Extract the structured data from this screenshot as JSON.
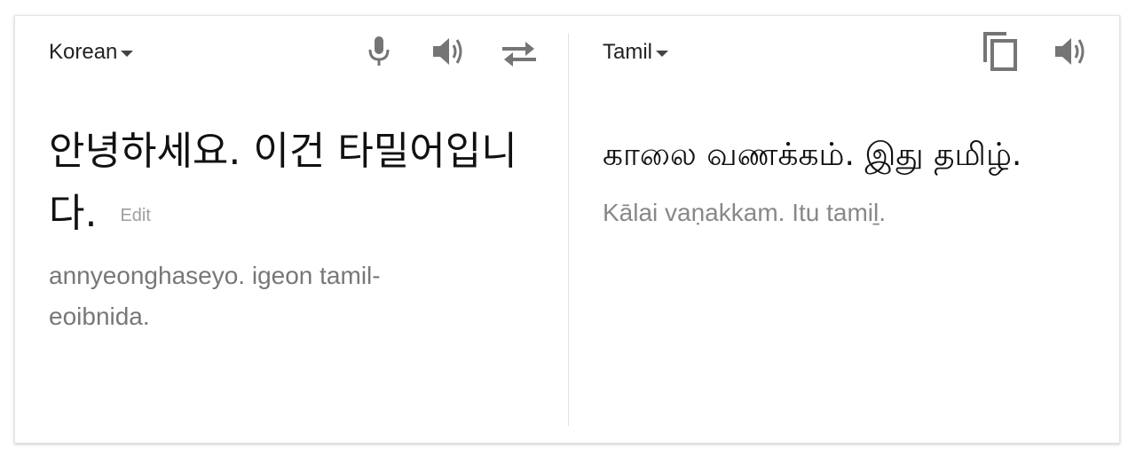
{
  "source": {
    "language": "Korean",
    "text": "안녕하세요. 이건 타밀어입니다.",
    "edit_label": "Edit",
    "transliteration": "annyeonghaseyo. igeon tamil-eoibnida."
  },
  "target": {
    "language": "Tamil",
    "text": "காலை வணக்கம். இது தமிழ்.",
    "transliteration": "Kālai vaṇakkam. Itu tamiḻ."
  },
  "icons": {
    "source_toolbar": [
      "microphone-icon",
      "speaker-icon",
      "swap-languages-icon"
    ],
    "target_toolbar": [
      "copy-icon",
      "speaker-icon"
    ]
  },
  "colors": {
    "icon": "#757575",
    "primary_text": "#111111",
    "secondary_text": "#777777",
    "edit_link": "#9e9e9e"
  }
}
